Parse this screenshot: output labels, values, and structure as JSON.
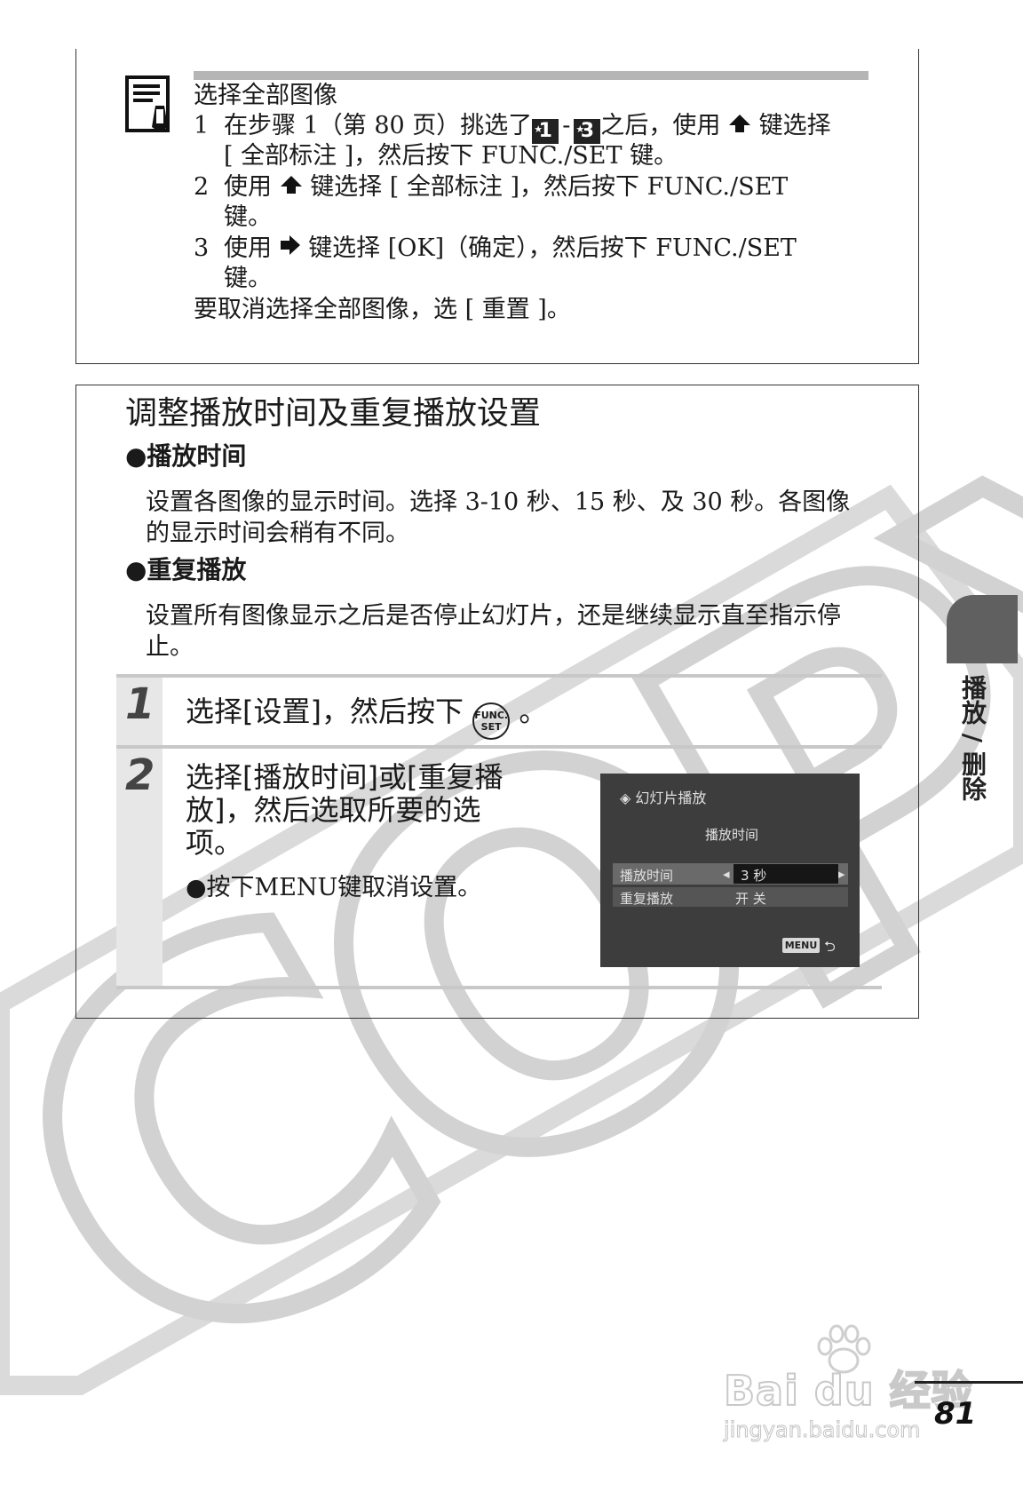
{
  "note": {
    "title": "选择全部图像",
    "items": [
      {
        "num": "1",
        "pre": "在步骤 1（第 80 页）挑选了",
        "icon1": "1",
        "dash": "-",
        "icon2": "3",
        "post": "之后，使用",
        "arrow": "up",
        "tail": "键选择",
        "cont": "[ 全部标注 ]，然后按下 FUNC./SET 键。"
      },
      {
        "num": "2",
        "pre": "使用",
        "arrow": "up",
        "post": "键选择 [ 全部标注 ]，然后按下 FUNC./SET",
        "cont": "键。"
      },
      {
        "num": "3",
        "pre": "使用",
        "arrow": "right",
        "post": "键选择 [OK]（确定），然后按下 FUNC./SET",
        "cont": "键。"
      }
    ],
    "footer": "要取消选择全部图像，选 [ 重置 ]。",
    "icon": "memo-icon"
  },
  "section": {
    "title": "调整播放时间及重复播放设置",
    "subheads": [
      {
        "label": "●播放时间",
        "text": "设置各图像的显示时间。选择 3-10 秒、15 秒、及 30 秒。各图像的显示时间会稍有不同。"
      },
      {
        "label": "●重复播放",
        "text": "设置所有图像显示之后是否停止幻灯片，还是继续显示直至指示停止。"
      }
    ]
  },
  "steps": [
    {
      "num": "1",
      "text": "选择[设置]，然后按下",
      "button": "FUNC. SET",
      "button_top": "FUNC.",
      "button_bottom": "SET",
      "end": "。"
    },
    {
      "num": "2",
      "lines": [
        "选择[播放时间]或[重复播",
        "放]，然后选取所要的选",
        "项。"
      ],
      "bullet": "●按下MENU键取消设置。"
    }
  ],
  "lcd": {
    "header": "◈ 幻灯片播放",
    "subtitle": "播放时间",
    "rows": [
      {
        "label": "播放时间",
        "value": "3 秒"
      },
      {
        "label": "重复播放",
        "value": "开  关"
      }
    ],
    "menu": "MENU",
    "return_icon": "return-icon"
  },
  "side_tab": {
    "label": "播放 / 删除"
  },
  "page_number": "81",
  "watermark": {
    "text": "COPY"
  },
  "baidu": {
    "logo": "Bai du 经验",
    "url": "jingyan.baidu.com"
  }
}
